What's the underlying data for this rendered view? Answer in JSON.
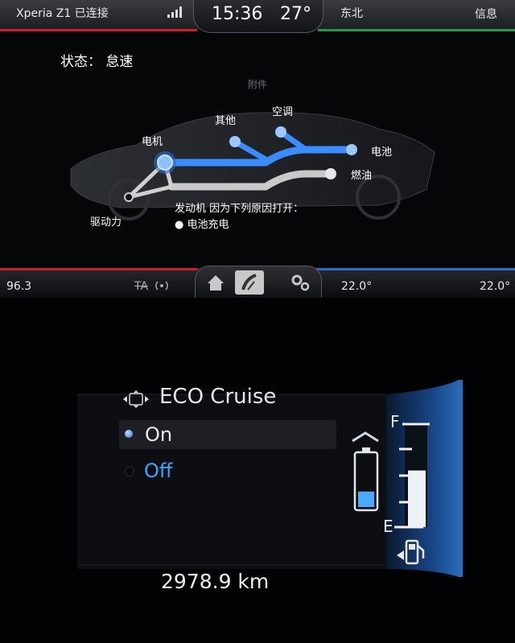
{
  "sync": {
    "phone_status": "Xperia Z1 已连接",
    "clock": "15:36",
    "outside_temp": "27°",
    "compass": "东北",
    "info_label": "信息",
    "status_text": "状态： 怠速",
    "accessory_label": "附件",
    "flow_labels": {
      "motor": "电机",
      "other": "其他",
      "ac": "空调",
      "battery": "电池",
      "fuel": "燃油",
      "drive": "驱动力"
    },
    "engine_reason_title": "发动机 因为下列原因打开：",
    "engine_reason_item": "● 电池充电",
    "radio_freq": "96.3",
    "ta_label": "TA",
    "driver_temp": "22.0°",
    "passenger_temp": "22.0°",
    "colors": {
      "accent_red": "#c8202a",
      "accent_green": "#1f9a4a",
      "accent_blue": "#2a6cd0",
      "flow_blue": "#3b8cff"
    },
    "icons": [
      "signal-icon",
      "radio-icon",
      "home-icon",
      "car-icon",
      "settings-icon"
    ]
  },
  "cluster": {
    "menu_title": "ECO Cruise",
    "options": [
      {
        "label": "On",
        "selected": true
      },
      {
        "label": "Off",
        "selected": false
      }
    ],
    "odometer": "2978.9 km",
    "fuel_full_label": "F",
    "fuel_empty_label": "E",
    "fuel_level": 0.55,
    "battery_level": 0.3,
    "colors": {
      "highlight": "#3aa6ff",
      "glow": "#1e5fb0"
    },
    "icons": [
      "dpad-icon",
      "chevron-up-icon",
      "battery-icon",
      "fuel-pump-icon"
    ]
  }
}
